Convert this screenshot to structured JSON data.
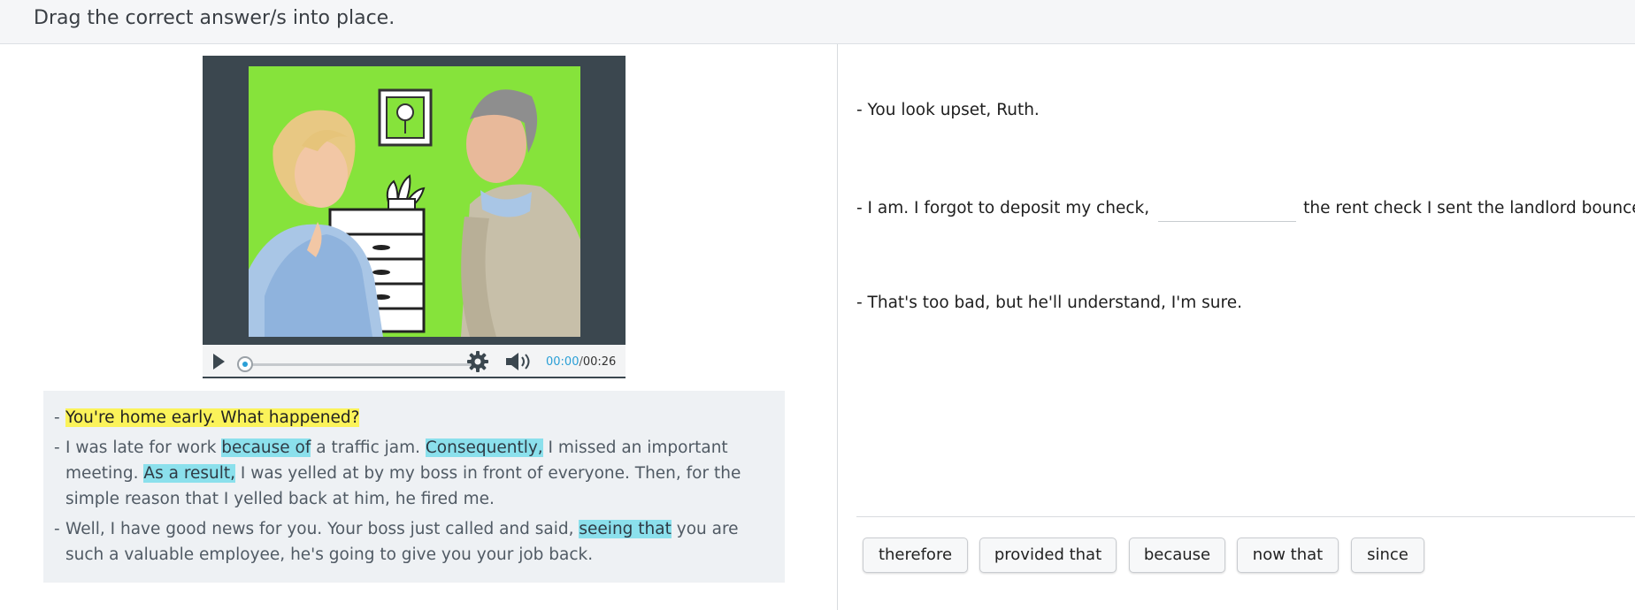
{
  "header": {
    "instruction": "Drag the correct answer/s into place."
  },
  "video": {
    "current_time": "00:00",
    "separator": "/",
    "duration": "00:26",
    "progress": 0
  },
  "transcript": [
    {
      "dash": "-",
      "parts": [
        {
          "text": "You're home early. What happened?",
          "hl": "yellow"
        }
      ]
    },
    {
      "dash": "-",
      "parts": [
        {
          "text": "I was late for work ",
          "hl": ""
        },
        {
          "text": "because of",
          "hl": "cyan"
        },
        {
          "text": " a traffic jam. ",
          "hl": ""
        },
        {
          "text": "Consequently,",
          "hl": "cyan"
        },
        {
          "text": " I missed an important meeting. ",
          "hl": ""
        },
        {
          "text": "As a result,",
          "hl": "cyan"
        },
        {
          "text": " I was yelled at by my boss in front of everyone. Then, for the simple reason that I yelled back at him, he fired me.",
          "hl": ""
        }
      ]
    },
    {
      "dash": "-",
      "parts": [
        {
          "text": "Well, I have good news for you. Your boss just called and said, ",
          "hl": ""
        },
        {
          "text": "seeing that",
          "hl": "cyan"
        },
        {
          "text": " you are such a valuable employee, he's going to give you your job back.",
          "hl": ""
        }
      ]
    }
  ],
  "dialogue": {
    "line1": "- You look upset, Ruth.",
    "line2_before": "- I am. I forgot to deposit my check,",
    "line2_after": "the rent check I sent the landlord bounced.",
    "line3": "- That's too bad, but he'll understand, I'm sure."
  },
  "word_bank": [
    "therefore",
    "provided that",
    "because",
    "now that",
    "since"
  ],
  "colors": {
    "highlight_yellow": "#fbf35a",
    "highlight_cyan": "#8be0ec",
    "video_bg": "#86e33b",
    "accent": "#2a9fd6"
  }
}
